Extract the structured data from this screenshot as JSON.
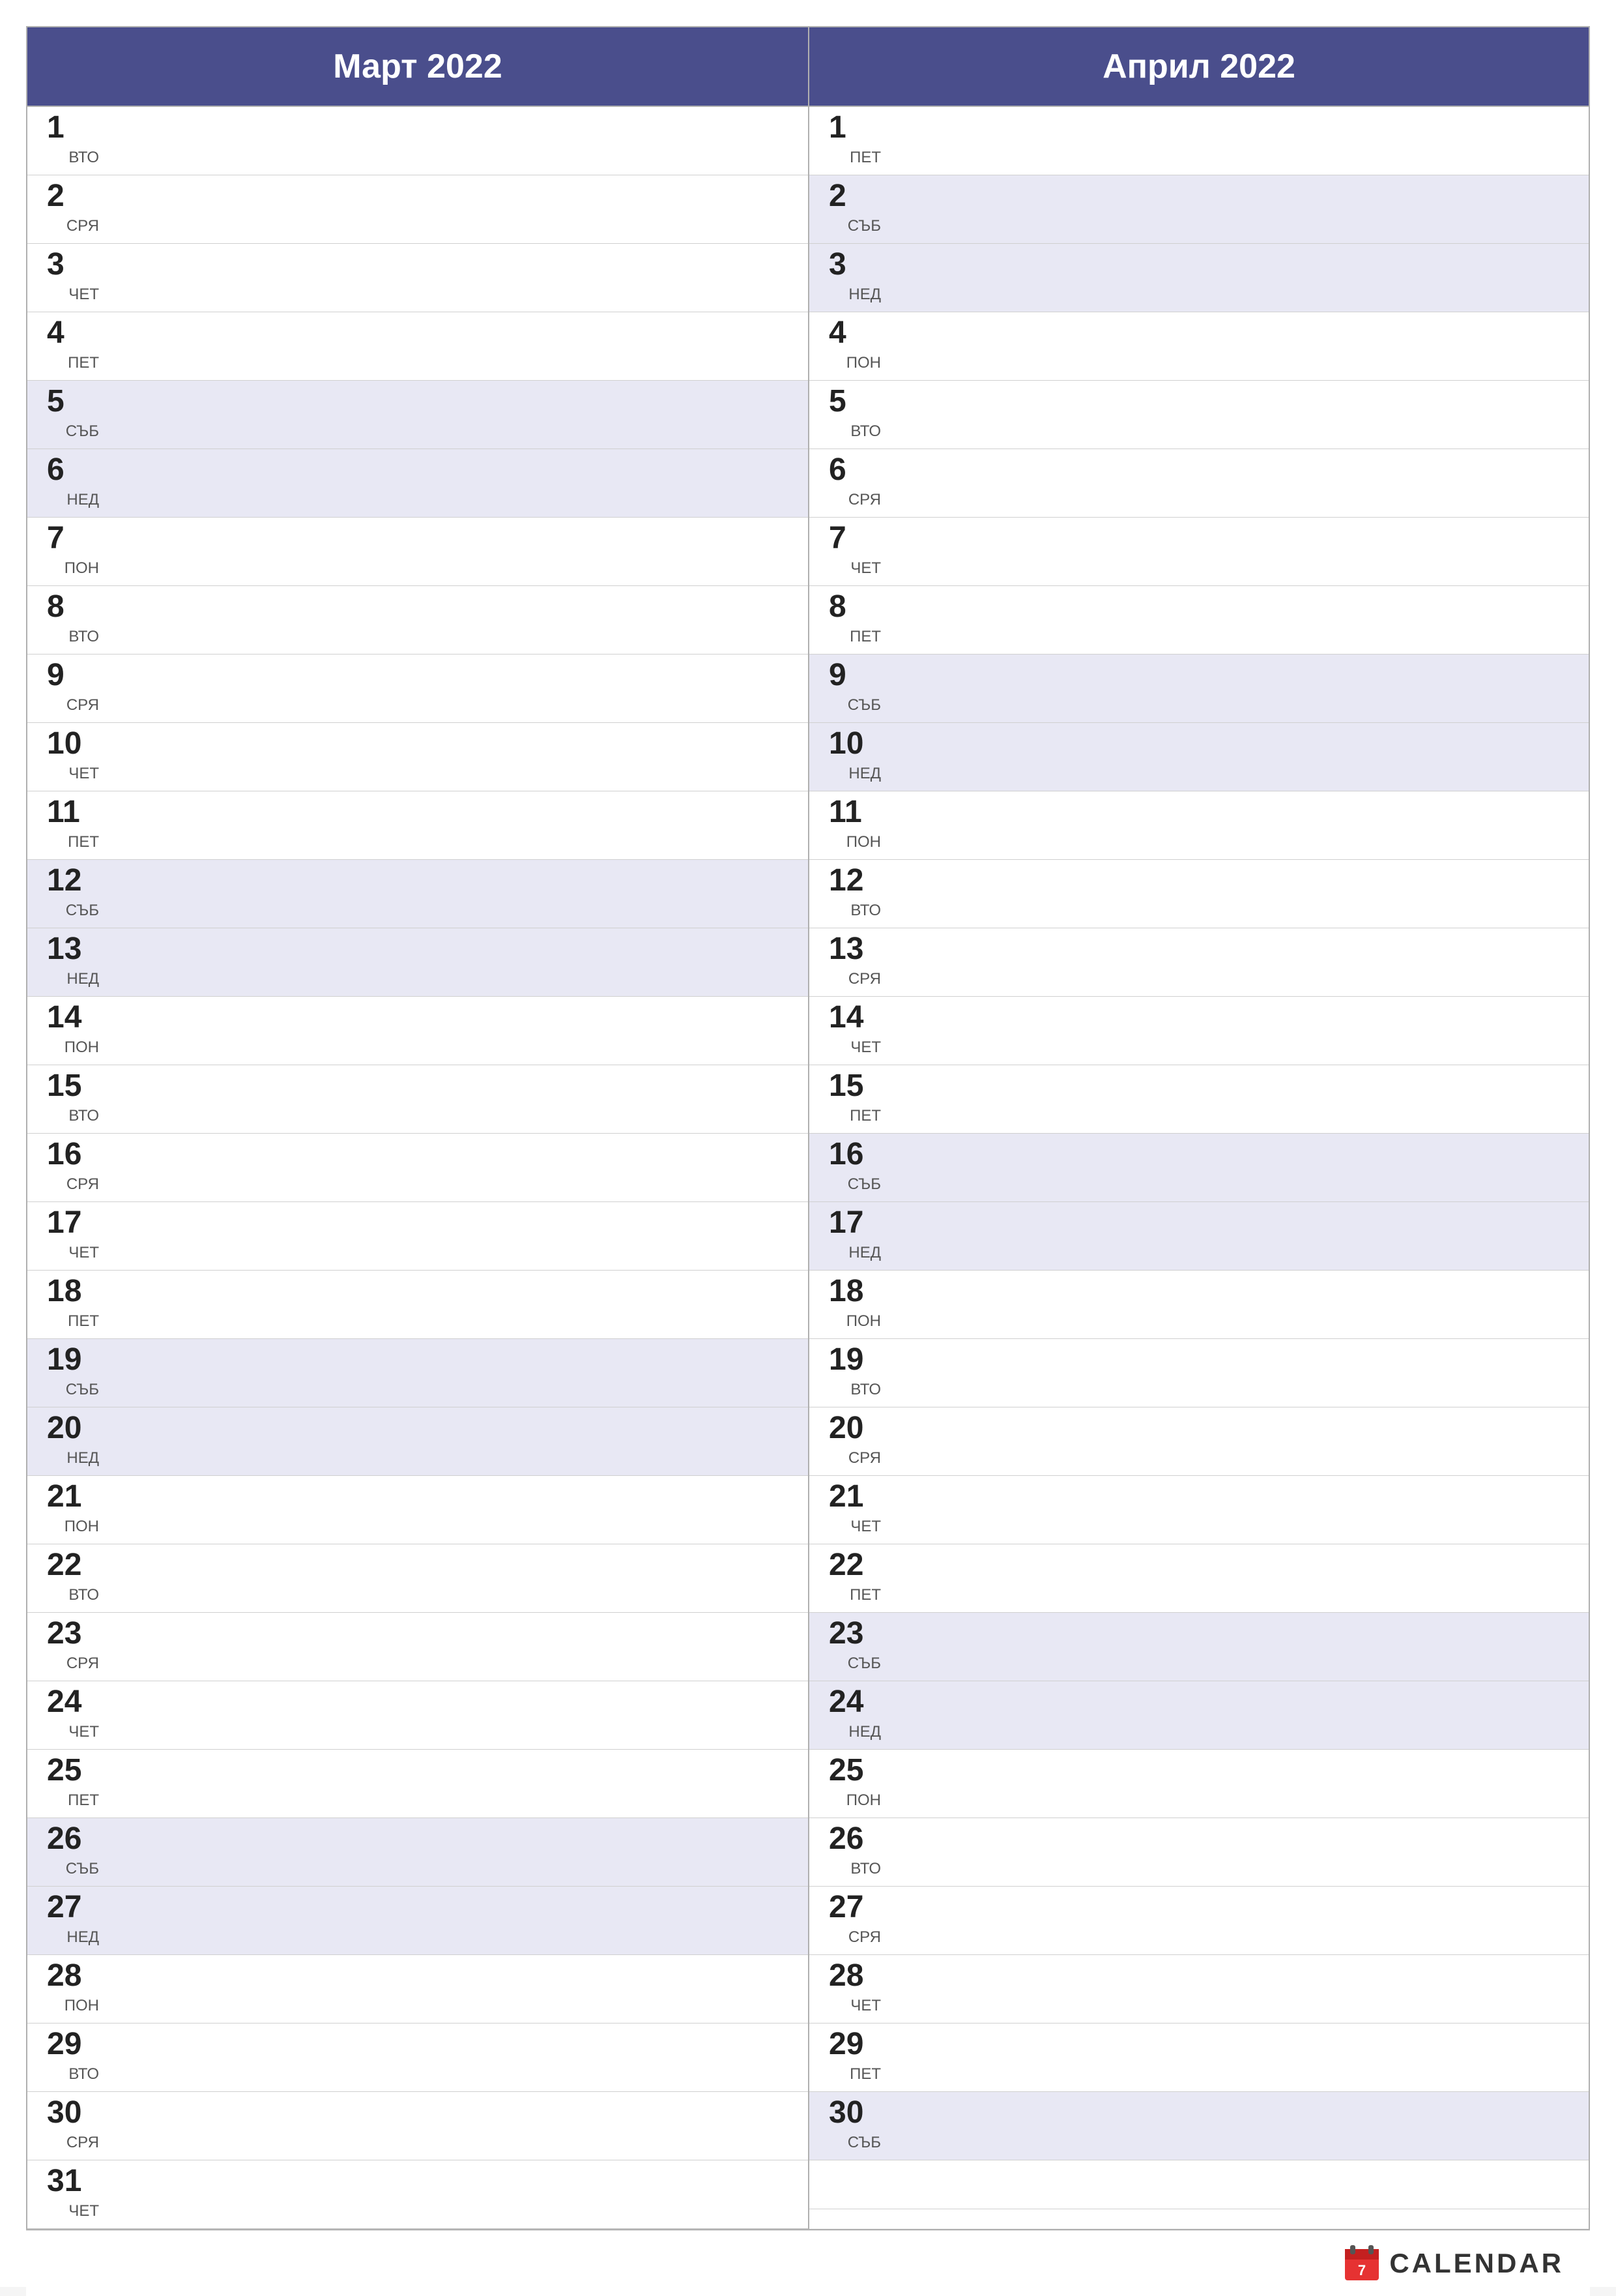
{
  "calendar": {
    "month1": {
      "title": "Март 2022",
      "days": [
        {
          "num": "1",
          "name": "ВТО",
          "weekend": false
        },
        {
          "num": "2",
          "name": "СРЯ",
          "weekend": false
        },
        {
          "num": "3",
          "name": "ЧЕТ",
          "weekend": false
        },
        {
          "num": "4",
          "name": "ПЕТ",
          "weekend": false
        },
        {
          "num": "5",
          "name": "СЪБ",
          "weekend": true
        },
        {
          "num": "6",
          "name": "НЕД",
          "weekend": true
        },
        {
          "num": "7",
          "name": "ПОН",
          "weekend": false
        },
        {
          "num": "8",
          "name": "ВТО",
          "weekend": false
        },
        {
          "num": "9",
          "name": "СРЯ",
          "weekend": false
        },
        {
          "num": "10",
          "name": "ЧЕТ",
          "weekend": false
        },
        {
          "num": "11",
          "name": "ПЕТ",
          "weekend": false
        },
        {
          "num": "12",
          "name": "СЪБ",
          "weekend": true
        },
        {
          "num": "13",
          "name": "НЕД",
          "weekend": true
        },
        {
          "num": "14",
          "name": "ПОН",
          "weekend": false
        },
        {
          "num": "15",
          "name": "ВТО",
          "weekend": false
        },
        {
          "num": "16",
          "name": "СРЯ",
          "weekend": false
        },
        {
          "num": "17",
          "name": "ЧЕТ",
          "weekend": false
        },
        {
          "num": "18",
          "name": "ПЕТ",
          "weekend": false
        },
        {
          "num": "19",
          "name": "СЪБ",
          "weekend": true
        },
        {
          "num": "20",
          "name": "НЕД",
          "weekend": true
        },
        {
          "num": "21",
          "name": "ПОН",
          "weekend": false
        },
        {
          "num": "22",
          "name": "ВТО",
          "weekend": false
        },
        {
          "num": "23",
          "name": "СРЯ",
          "weekend": false
        },
        {
          "num": "24",
          "name": "ЧЕТ",
          "weekend": false
        },
        {
          "num": "25",
          "name": "ПЕТ",
          "weekend": false
        },
        {
          "num": "26",
          "name": "СЪБ",
          "weekend": true
        },
        {
          "num": "27",
          "name": "НЕД",
          "weekend": true
        },
        {
          "num": "28",
          "name": "ПОН",
          "weekend": false
        },
        {
          "num": "29",
          "name": "ВТО",
          "weekend": false
        },
        {
          "num": "30",
          "name": "СРЯ",
          "weekend": false
        },
        {
          "num": "31",
          "name": "ЧЕТ",
          "weekend": false
        }
      ]
    },
    "month2": {
      "title": "Април 2022",
      "days": [
        {
          "num": "1",
          "name": "ПЕТ",
          "weekend": false
        },
        {
          "num": "2",
          "name": "СЪБ",
          "weekend": true
        },
        {
          "num": "3",
          "name": "НЕД",
          "weekend": true
        },
        {
          "num": "4",
          "name": "ПОН",
          "weekend": false
        },
        {
          "num": "5",
          "name": "ВТО",
          "weekend": false
        },
        {
          "num": "6",
          "name": "СРЯ",
          "weekend": false
        },
        {
          "num": "7",
          "name": "ЧЕТ",
          "weekend": false
        },
        {
          "num": "8",
          "name": "ПЕТ",
          "weekend": false
        },
        {
          "num": "9",
          "name": "СЪБ",
          "weekend": true
        },
        {
          "num": "10",
          "name": "НЕД",
          "weekend": true
        },
        {
          "num": "11",
          "name": "ПОН",
          "weekend": false
        },
        {
          "num": "12",
          "name": "ВТО",
          "weekend": false
        },
        {
          "num": "13",
          "name": "СРЯ",
          "weekend": false
        },
        {
          "num": "14",
          "name": "ЧЕТ",
          "weekend": false
        },
        {
          "num": "15",
          "name": "ПЕТ",
          "weekend": false
        },
        {
          "num": "16",
          "name": "СЪБ",
          "weekend": true
        },
        {
          "num": "17",
          "name": "НЕД",
          "weekend": true
        },
        {
          "num": "18",
          "name": "ПОН",
          "weekend": false
        },
        {
          "num": "19",
          "name": "ВТО",
          "weekend": false
        },
        {
          "num": "20",
          "name": "СРЯ",
          "weekend": false
        },
        {
          "num": "21",
          "name": "ЧЕТ",
          "weekend": false
        },
        {
          "num": "22",
          "name": "ПЕТ",
          "weekend": false
        },
        {
          "num": "23",
          "name": "СЪБ",
          "weekend": true
        },
        {
          "num": "24",
          "name": "НЕД",
          "weekend": true
        },
        {
          "num": "25",
          "name": "ПОН",
          "weekend": false
        },
        {
          "num": "26",
          "name": "ВТО",
          "weekend": false
        },
        {
          "num": "27",
          "name": "СРЯ",
          "weekend": false
        },
        {
          "num": "28",
          "name": "ЧЕТ",
          "weekend": false
        },
        {
          "num": "29",
          "name": "ПЕТ",
          "weekend": false
        },
        {
          "num": "30",
          "name": "СЪБ",
          "weekend": true
        }
      ]
    }
  },
  "brand": {
    "text": "CALENDAR",
    "accent_color": "#e63232"
  }
}
